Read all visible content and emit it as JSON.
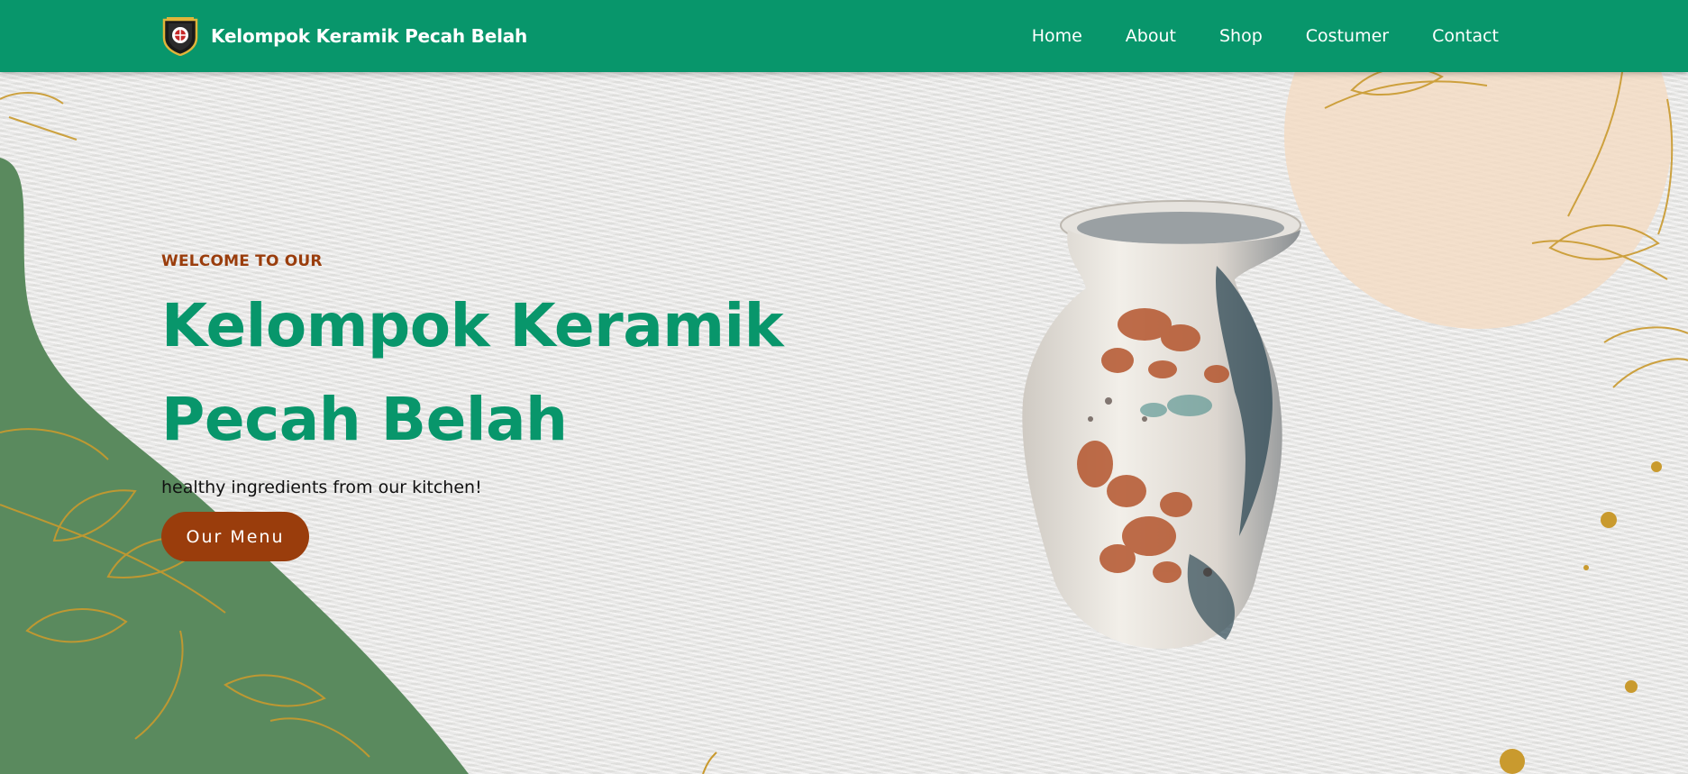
{
  "navbar": {
    "brand_name": "Kelompok Keramik Pecah Belah",
    "links": [
      "Home",
      "About",
      "Shop",
      "Costumer",
      "Contact"
    ]
  },
  "hero": {
    "welcome": "WELCOME TO OUR",
    "title": "Kelompok Keramik Pecah Belah",
    "subtitle": "healthy ingredients from our kitchen!",
    "button_label": "Our Menu"
  },
  "colors": {
    "primary_green": "#08966b",
    "accent_brown": "#9a3d0c",
    "leaf_green": "#5a8a5e",
    "gold": "#c99a2e",
    "peach": "#f3dcc4"
  },
  "icons": {
    "brand_logo": "shield-emblem-icon"
  }
}
